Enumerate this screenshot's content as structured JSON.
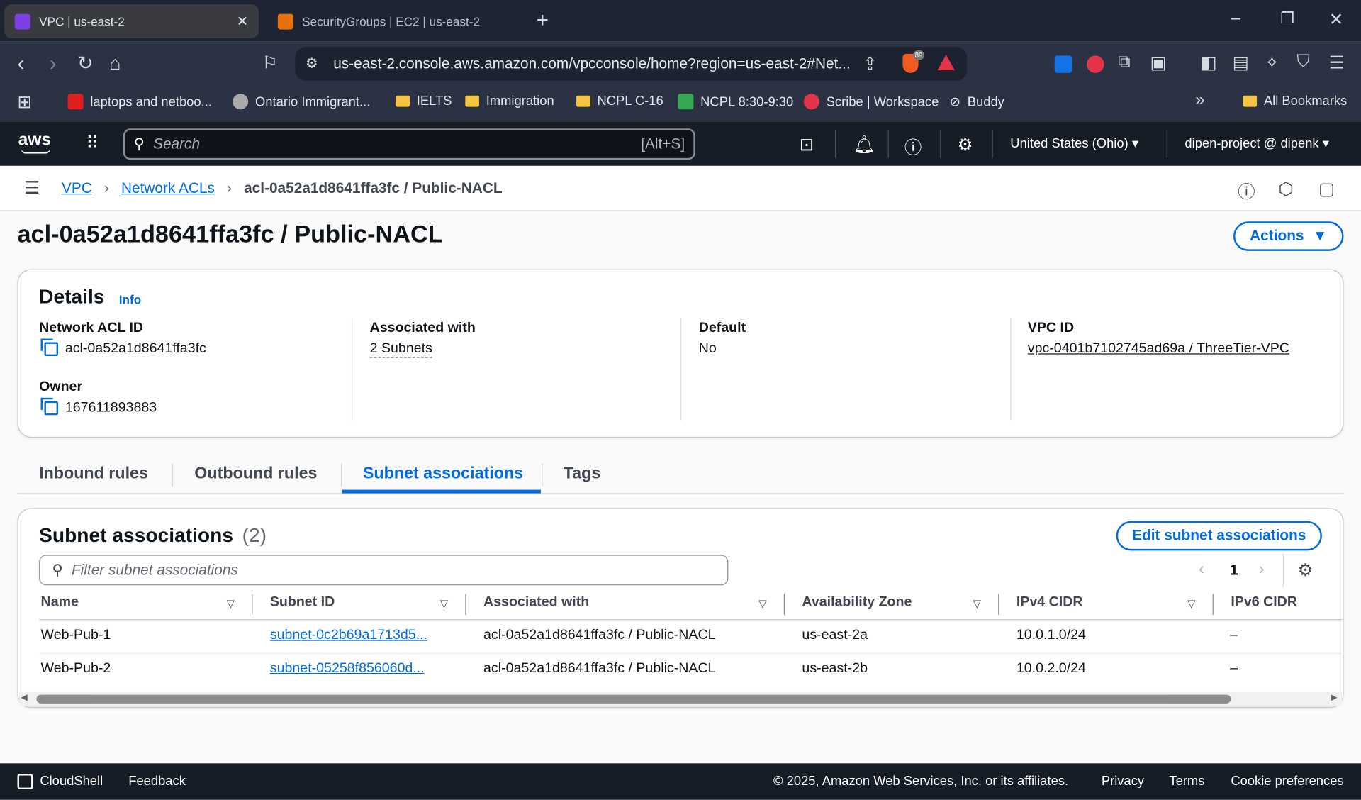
{
  "browser": {
    "tabs": [
      {
        "title": "VPC | us-east-2",
        "active": true
      },
      {
        "title": "SecurityGroups | EC2 | us-east-2",
        "active": false
      }
    ],
    "url": "us-east-2.console.aws.amazon.com/vpcconsole/home?region=us-east-2#Net...",
    "brave_badge": "89",
    "bookmarks": [
      "laptops and netboo...",
      "Ontario Immigrant...",
      "IELTS",
      "Immigration",
      "NCPL C-16",
      "NCPL 8:30-9:30",
      "Scribe | Workspace",
      "Buddy"
    ],
    "all_bookmarks": "All Bookmarks"
  },
  "aws_nav": {
    "logo": "aws",
    "search_placeholder": "Search",
    "search_shortcut": "[Alt+S]",
    "region": "United States (Ohio)",
    "account": "dipen-project @ dipenk"
  },
  "breadcrumb": [
    "VPC",
    "Network ACLs",
    "acl-0a52a1d8641ffa3fc / Public-NACL"
  ],
  "page_title": "acl-0a52a1d8641ffa3fc / Public-NACL",
  "actions_label": "Actions",
  "details": {
    "title": "Details",
    "info": "Info",
    "network_acl_id_label": "Network ACL ID",
    "network_acl_id": "acl-0a52a1d8641ffa3fc",
    "owner_label": "Owner",
    "owner": "167611893883",
    "associated_label": "Associated with",
    "associated": "2 Subnets",
    "default_label": "Default",
    "default": "No",
    "vpc_label": "VPC ID",
    "vpc": "vpc-0401b7102745ad69a / ThreeTier-VPC"
  },
  "tabs": [
    "Inbound rules",
    "Outbound rules",
    "Subnet associations",
    "Tags"
  ],
  "subnets": {
    "title": "Subnet associations",
    "count": "(2)",
    "edit_label": "Edit subnet associations",
    "filter_placeholder": "Filter subnet associations",
    "page": "1",
    "columns": [
      "Name",
      "Subnet ID",
      "Associated with",
      "Availability Zone",
      "IPv4 CIDR",
      "IPv6 CIDR"
    ],
    "rows": [
      [
        "Web-Pub-1",
        "subnet-0c2b69a1713d5...",
        "acl-0a52a1d8641ffa3fc / Public-NACL",
        "us-east-2a",
        "10.0.1.0/24",
        "–"
      ],
      [
        "Web-Pub-2",
        "subnet-05258f856060d...",
        "acl-0a52a1d8641ffa3fc / Public-NACL",
        "us-east-2b",
        "10.0.2.0/24",
        "–"
      ]
    ]
  },
  "footer": {
    "cloudshell": "CloudShell",
    "feedback": "Feedback",
    "copyright": "© 2025, Amazon Web Services, Inc. or its affiliates.",
    "privacy": "Privacy",
    "terms": "Terms",
    "cookies": "Cookie preferences"
  },
  "colors": {
    "link": "#006ce0",
    "nav_bg": "#161d26"
  }
}
